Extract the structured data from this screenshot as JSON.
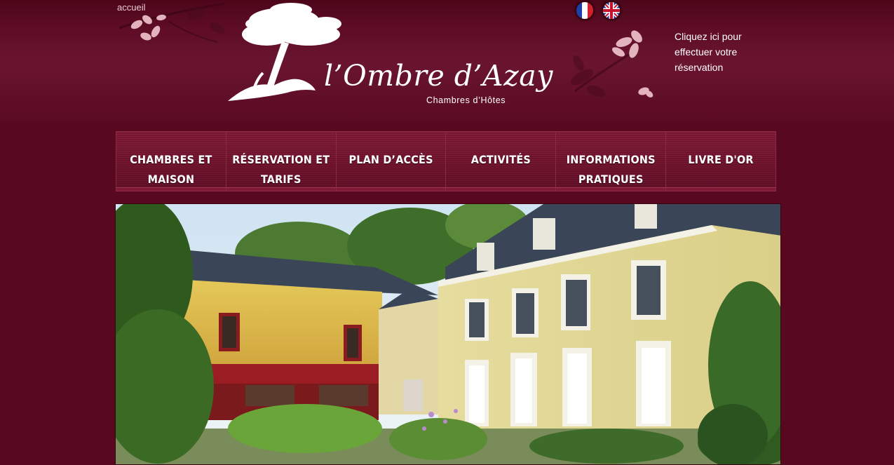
{
  "breadcrumb": {
    "label": "accueil"
  },
  "logo": {
    "title": "l’Ombre d’Azay",
    "subtitle": "Chambres d’Hôtes"
  },
  "languages": [
    {
      "icon": "french-flag-icon"
    },
    {
      "icon": "uk-flag-icon"
    }
  ],
  "reservation": {
    "line1": "Cliquez ici pour",
    "line2": "effectuer votre",
    "line3": "réservation"
  },
  "nav": {
    "items": [
      {
        "line1": "CHAMBRES ET",
        "line2": "MAISON"
      },
      {
        "line1": "RÉSERVATION ET",
        "line2": "TARIFS"
      },
      {
        "line1": "PLAN D’ACCÈS",
        "line2": ""
      },
      {
        "line1": "ACTIVITÉS",
        "line2": ""
      },
      {
        "line1": "INFORMATIONS",
        "line2": "PRATIQUES"
      },
      {
        "line1": "LIVRE D'OR",
        "line2": ""
      }
    ]
  },
  "colors": {
    "background": "#58081f",
    "nav_border": "#8c2a45",
    "text": "#ffffff"
  }
}
